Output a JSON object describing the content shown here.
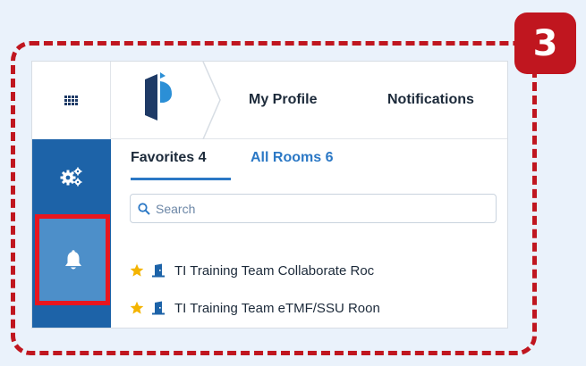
{
  "step": {
    "number": "3"
  },
  "header": {
    "nav": [
      {
        "label": "My Profile"
      },
      {
        "label": "Notifications"
      }
    ]
  },
  "rooms": {
    "tabs": [
      {
        "label": "Favorites 4",
        "active": true
      },
      {
        "label": "All Rooms 6",
        "active": false
      }
    ],
    "search": {
      "placeholder": "Search",
      "value": ""
    },
    "items": [
      {
        "name": "TI Training Team Collaborate Roc",
        "favorite": true,
        "icon": "door-icon"
      },
      {
        "name": "TI Training Team eTMF/SSU Roon",
        "favorite": true,
        "icon": "door-icon"
      }
    ]
  },
  "colors": {
    "accent_red": "#c0161f",
    "highlight_red": "#e8161f",
    "rail_blue": "#1d63a8",
    "rail_active": "#4d8fc9",
    "link_blue": "#2b78c5",
    "star": "#f4b400",
    "page_bg": "#eaf2fb"
  }
}
